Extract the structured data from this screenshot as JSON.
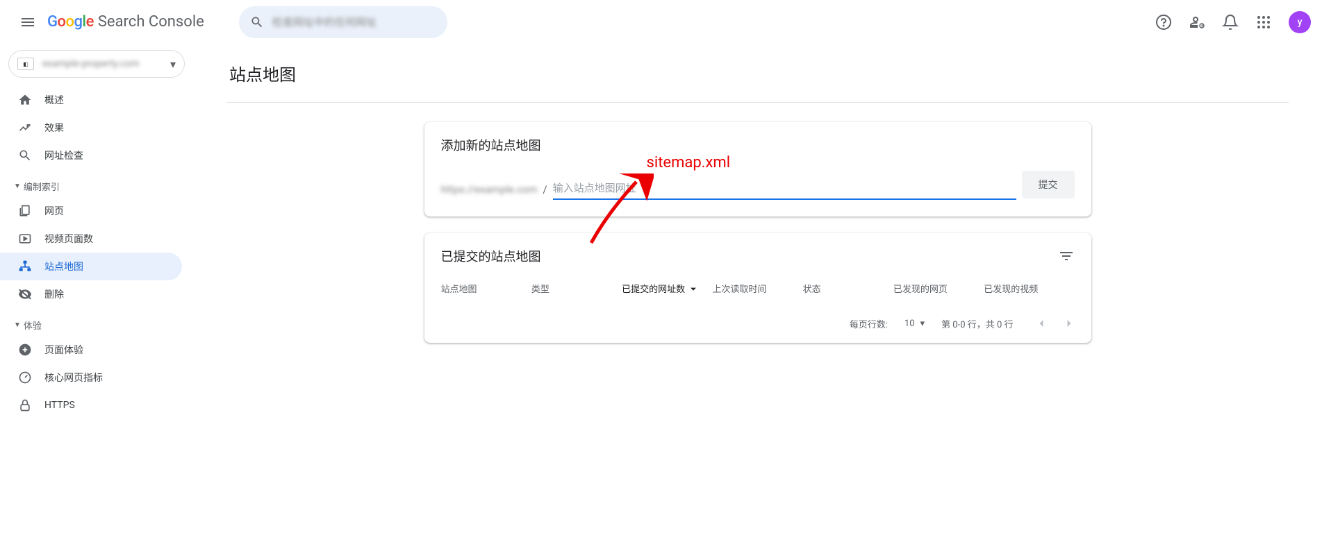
{
  "header": {
    "logo_suffix": "Search Console",
    "avatar_letter": "y"
  },
  "sidebar": {
    "items": {
      "overview": "概述",
      "performance": "效果",
      "url_inspection": "网址检查",
      "pages": "网页",
      "video_pages": "视频页面数",
      "sitemaps": "站点地图",
      "removals": "删除",
      "page_experience": "页面体验",
      "core_web_vitals": "核心网页指标",
      "https": "HTTPS"
    },
    "sections": {
      "indexing": "编制索引",
      "experience": "体验"
    }
  },
  "main": {
    "page_title": "站点地图",
    "add_card": {
      "title": "添加新的站点地图",
      "placeholder": "输入站点地图网址",
      "submit": "提交"
    },
    "submitted_card": {
      "title": "已提交的站点地图",
      "columns": {
        "sitemap": "站点地图",
        "type": "类型",
        "submitted_urls": "已提交的网址数",
        "last_read": "上次读取时间",
        "status": "状态",
        "discovered_pages": "已发现的网页",
        "discovered_videos": "已发现的视频"
      },
      "pagination": {
        "rows_label": "每页行数:",
        "rows_value": "10",
        "range": "第 0-0 行，共 0 行"
      }
    },
    "annotation_text": "sitemap.xml"
  }
}
